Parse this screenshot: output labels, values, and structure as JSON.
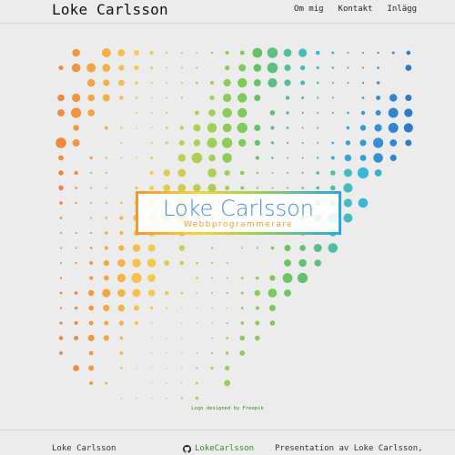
{
  "header": {
    "site_title": "Loke Carlsson",
    "nav": [
      {
        "label": "Om mig"
      },
      {
        "label": "Kontakt"
      },
      {
        "label": "Inlägg"
      }
    ]
  },
  "hero": {
    "logo_name": "Loke Carlsson",
    "logo_subtitle": "Webbprogrammerare",
    "credit": "Logo designed by Freepik"
  },
  "footer": {
    "name": "Loke Carlsson",
    "github_label": "LokeCarlsson",
    "github_icon": "github-icon",
    "description": "Presentation av Loke Carlsson,"
  },
  "colors": {
    "background": "#ececec",
    "accent_blue": "#4a90c9",
    "accent_orange": "#f0a030",
    "link_green": "#2e8b2e"
  }
}
